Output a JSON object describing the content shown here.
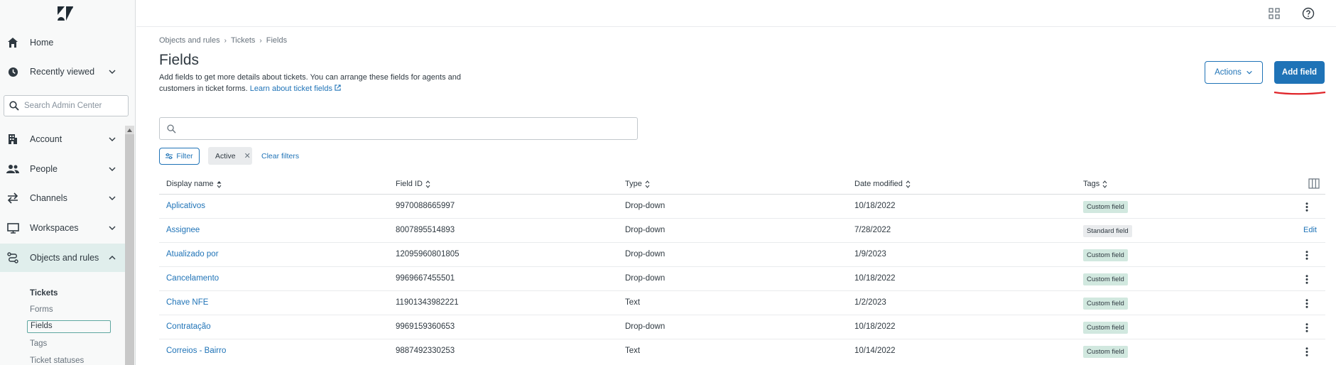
{
  "sidebar": {
    "nav": [
      {
        "label": "Home",
        "icon": "home-icon"
      },
      {
        "label": "Recently viewed",
        "icon": "clock-icon"
      },
      {
        "label": "Account",
        "icon": "building-icon"
      },
      {
        "label": "People",
        "icon": "people-icon"
      },
      {
        "label": "Channels",
        "icon": "arrows-icon"
      },
      {
        "label": "Workspaces",
        "icon": "monitor-icon"
      },
      {
        "label": "Objects and rules",
        "icon": "objects-icon"
      }
    ],
    "search_placeholder": "Search Admin Center",
    "subnav": {
      "heading": "Tickets",
      "items": [
        "Forms",
        "Fields",
        "Tags",
        "Ticket statuses"
      ]
    }
  },
  "breadcrumb": [
    "Objects and rules",
    "Tickets",
    "Fields"
  ],
  "page": {
    "title": "Fields",
    "description": "Add fields to get more details about tickets. You can arrange these fields for agents and customers in ticket forms.",
    "learn_link": "Learn about ticket fields",
    "actions_label": "Actions",
    "add_label": "Add field"
  },
  "filters": {
    "filter_label": "Filter",
    "chip_label": "Active",
    "clear_label": "Clear filters"
  },
  "table": {
    "columns": [
      "Display name",
      "Field ID",
      "Type",
      "Date modified",
      "Tags"
    ],
    "rows": [
      {
        "name": "Aplicativos",
        "id": "9970088665997",
        "type": "Drop-down",
        "date": "10/18/2022",
        "tag": "Custom field"
      },
      {
        "name": "Assignee",
        "id": "8007895514893",
        "type": "Drop-down",
        "date": "7/28/2022",
        "tag": "Standard field",
        "action": "Edit"
      },
      {
        "name": "Atualizado por",
        "id": "12095960801805",
        "type": "Drop-down",
        "date": "1/9/2023",
        "tag": "Custom field"
      },
      {
        "name": "Cancelamento",
        "id": "9969667455501",
        "type": "Drop-down",
        "date": "10/18/2022",
        "tag": "Custom field"
      },
      {
        "name": "Chave NFE",
        "id": "11901343982221",
        "type": "Text",
        "date": "1/2/2023",
        "tag": "Custom field"
      },
      {
        "name": "Contratação",
        "id": "9969159360653",
        "type": "Drop-down",
        "date": "10/18/2022",
        "tag": "Custom field"
      },
      {
        "name": "Correios - Bairro",
        "id": "9887492330253",
        "type": "Text",
        "date": "10/14/2022",
        "tag": "Custom field"
      }
    ]
  },
  "colors": {
    "brand": "#1f73b7",
    "active_nav": "#e0eeec",
    "custom_tag": "#d1e8df",
    "annotation": "#e0252a"
  }
}
